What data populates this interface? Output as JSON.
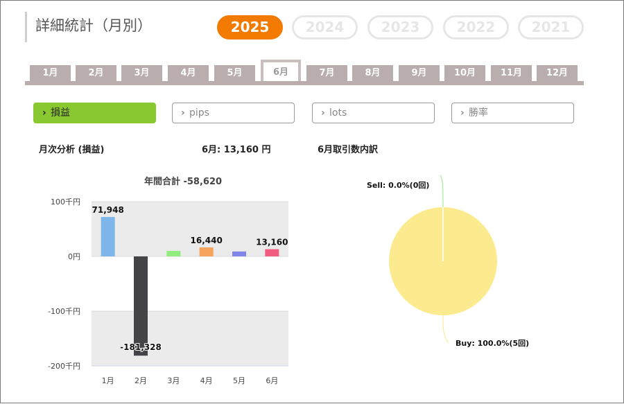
{
  "title": "詳細統計（月別）",
  "years": [
    {
      "label": "2025",
      "active": true
    },
    {
      "label": "2024",
      "active": false
    },
    {
      "label": "2023",
      "active": false
    },
    {
      "label": "2022",
      "active": false
    },
    {
      "label": "2021",
      "active": false
    }
  ],
  "months": [
    {
      "label": "1月",
      "active": false
    },
    {
      "label": "2月",
      "active": false
    },
    {
      "label": "3月",
      "active": false
    },
    {
      "label": "4月",
      "active": false
    },
    {
      "label": "5月",
      "active": false
    },
    {
      "label": "6月",
      "active": true
    },
    {
      "label": "7月",
      "active": false
    },
    {
      "label": "8月",
      "active": false
    },
    {
      "label": "9月",
      "active": false
    },
    {
      "label": "10月",
      "active": false
    },
    {
      "label": "11月",
      "active": false
    },
    {
      "label": "12月",
      "active": false
    }
  ],
  "metrics": [
    {
      "label": "損益",
      "active": true,
      "icon": "chevron-right-icon"
    },
    {
      "label": "pips",
      "active": false,
      "icon": "chevron-right-icon"
    },
    {
      "label": "lots",
      "active": false,
      "icon": "chevron-right-icon"
    },
    {
      "label": "勝率",
      "active": false,
      "icon": "chevron-right-icon"
    }
  ],
  "analysis_title": "月次分析 (損益)",
  "month_summary": "6月:  13,160 円",
  "breakdown_title": "6月取引数内訳",
  "colors": {
    "accent_year": "#f27a00",
    "accent_metric": "#8ac832",
    "tab": "#b9adad"
  },
  "chart_data": [
    {
      "type": "bar",
      "title": "年間合計 -58,620",
      "categories": [
        "1月",
        "2月",
        "3月",
        "4月",
        "5月",
        "6月"
      ],
      "values": [
        71948,
        -181328,
        10000,
        16440,
        9000,
        13160
      ],
      "data_labels": [
        "71,948",
        "-181,328",
        "",
        "16,440",
        "",
        "13,160"
      ],
      "colors": [
        "#7eb6e9",
        "#434348",
        "#90ed7d",
        "#f7a35c",
        "#8085e9",
        "#f15c80"
      ],
      "ylim": [
        -200000,
        100000
      ],
      "yticks": [
        100000,
        0,
        -100000,
        -200000
      ],
      "ytick_labels": [
        "100千円",
        "0円",
        "-100千円",
        "-200千円"
      ],
      "grid": true
    },
    {
      "type": "pie",
      "slices": [
        {
          "label": "Sell: 0.0%(0回)",
          "value": 0,
          "color": "#90ed7d"
        },
        {
          "label": "Buy: 100.0%(5回)",
          "value": 100,
          "color": "#fbeb8e"
        }
      ]
    }
  ]
}
